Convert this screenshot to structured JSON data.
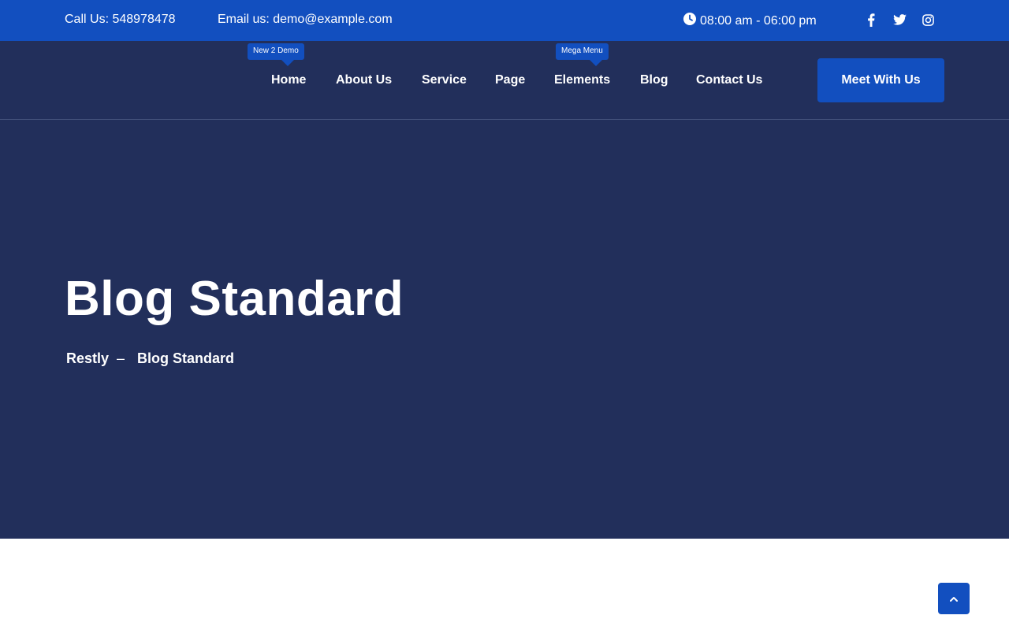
{
  "topbar": {
    "phone": "Call Us: 548978478",
    "email": "Email us: demo@example.com",
    "hours": "08:00 am - 06:00 pm",
    "social_icons": [
      "facebook-icon",
      "twitter-icon",
      "instagram-icon"
    ]
  },
  "nav": {
    "items": [
      {
        "label": "Home",
        "badge": "New 2 Demo"
      },
      {
        "label": "About Us"
      },
      {
        "label": "Service"
      },
      {
        "label": "Page"
      },
      {
        "label": "Elements",
        "badge": "Mega Menu"
      },
      {
        "label": "Blog"
      },
      {
        "label": "Contact Us"
      }
    ],
    "cta_label": "Meet With Us"
  },
  "hero": {
    "title": "Blog Standard",
    "breadcrumb": {
      "home": "Restly",
      "separator": "–",
      "current": "Blog Standard"
    }
  },
  "scroll_top_icon": "chevron-up-icon",
  "colors": {
    "brand_blue": "#124fbf",
    "navy": "#222f5b",
    "white": "#ffffff"
  }
}
